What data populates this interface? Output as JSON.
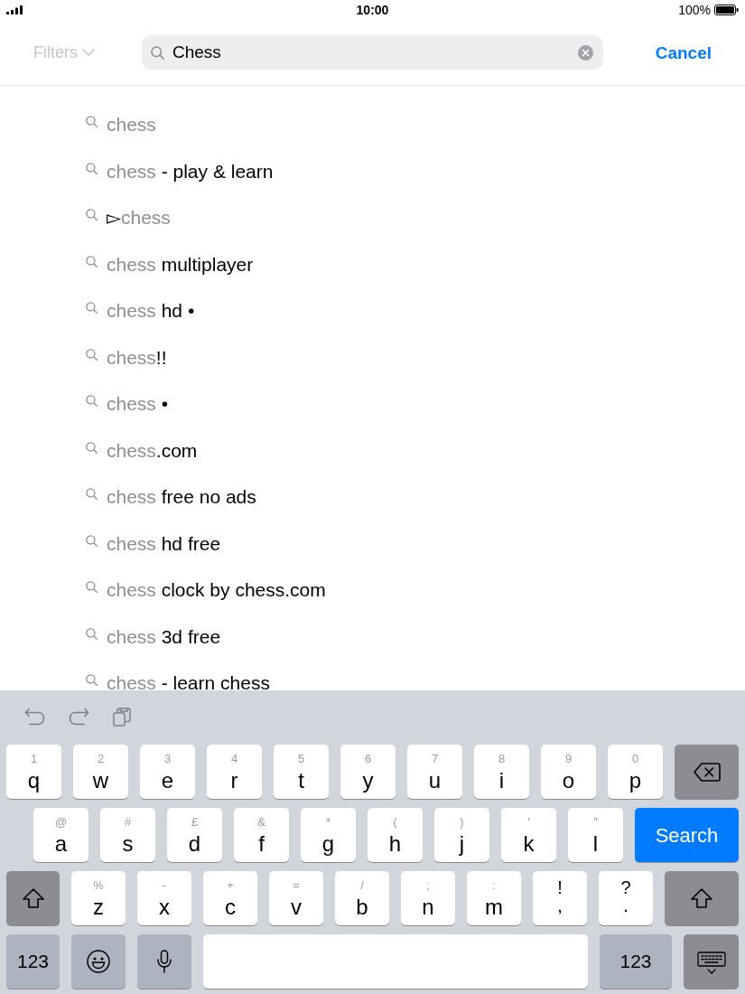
{
  "status_bar": {
    "time": "10:00",
    "battery": "100%"
  },
  "search_bar": {
    "filters": {
      "label": "Filters",
      "disabled": true
    },
    "field": {
      "value": "Chess"
    },
    "cancel": "Cancel"
  },
  "suggestions": [
    {
      "match": "chess"
    },
    {
      "match": "chess",
      "suffix": " - play & learn"
    },
    {
      "prefix": "▻",
      "match": "chess"
    },
    {
      "match": "chess",
      "suffix": " multiplayer"
    },
    {
      "match": "chess",
      "suffix": " hd •"
    },
    {
      "match": "chess",
      "suffix": "!!"
    },
    {
      "match": "chess",
      "suffix": " •"
    },
    {
      "match": "chess",
      "suffix": ".com"
    },
    {
      "match": "chess",
      "suffix": " free no ads"
    },
    {
      "match": "chess",
      "suffix": " hd free"
    },
    {
      "match": "chess",
      "suffix": " clock by chess.com"
    },
    {
      "match": "chess",
      "suffix": " 3d free"
    },
    {
      "match": "chess",
      "suffix": " - learn chess"
    }
  ],
  "keyboard": {
    "rows": [
      {
        "keys": [
          {
            "kind": "letter",
            "alt": "1",
            "label": "q"
          },
          {
            "kind": "letter",
            "alt": "2",
            "label": "w"
          },
          {
            "kind": "letter",
            "alt": "3",
            "label": "e"
          },
          {
            "kind": "letter",
            "alt": "4",
            "label": "r"
          },
          {
            "kind": "letter",
            "alt": "5",
            "label": "t"
          },
          {
            "kind": "letter",
            "alt": "6",
            "label": "y"
          },
          {
            "kind": "letter",
            "alt": "7",
            "label": "u"
          },
          {
            "kind": "letter",
            "alt": "8",
            "label": "i"
          },
          {
            "kind": "letter",
            "alt": "9",
            "label": "o"
          },
          {
            "kind": "letter",
            "alt": "0",
            "label": "p"
          },
          {
            "kind": "backspace"
          }
        ]
      },
      {
        "keys": [
          {
            "kind": "letter",
            "alt": "@",
            "label": "a"
          },
          {
            "kind": "letter",
            "alt": "#",
            "label": "s"
          },
          {
            "kind": "letter",
            "alt": "£",
            "label": "d"
          },
          {
            "kind": "letter",
            "alt": "&",
            "label": "f"
          },
          {
            "kind": "letter",
            "alt": "*",
            "label": "g"
          },
          {
            "kind": "letter",
            "alt": "(",
            "label": "h"
          },
          {
            "kind": "letter",
            "alt": ")",
            "label": "j"
          },
          {
            "kind": "letter",
            "alt": "′",
            "label": "k"
          },
          {
            "kind": "letter",
            "alt": "″",
            "label": "l"
          },
          {
            "kind": "search",
            "label": "Search"
          }
        ]
      },
      {
        "keys": [
          {
            "kind": "shift"
          },
          {
            "kind": "letter",
            "alt": "%",
            "label": "z"
          },
          {
            "kind": "letter",
            "alt": "-",
            "label": "x"
          },
          {
            "kind": "letter",
            "alt": "+",
            "label": "c"
          },
          {
            "kind": "letter",
            "alt": "=",
            "label": "v"
          },
          {
            "kind": "letter",
            "alt": "/",
            "label": "b"
          },
          {
            "kind": "letter",
            "alt": ";",
            "label": "n"
          },
          {
            "kind": "letter",
            "alt": ":",
            "label": "m"
          },
          {
            "kind": "punctuation",
            "alt": "!",
            "label": ","
          },
          {
            "kind": "punctuation",
            "alt": "?",
            "label": "."
          },
          {
            "kind": "shift"
          }
        ]
      },
      {
        "keys": [
          {
            "kind": "mode",
            "label": "123"
          },
          {
            "kind": "emoji"
          },
          {
            "kind": "dictation"
          },
          {
            "kind": "space"
          },
          {
            "kind": "mode",
            "label": "123"
          },
          {
            "kind": "dismiss"
          }
        ]
      }
    ]
  }
}
